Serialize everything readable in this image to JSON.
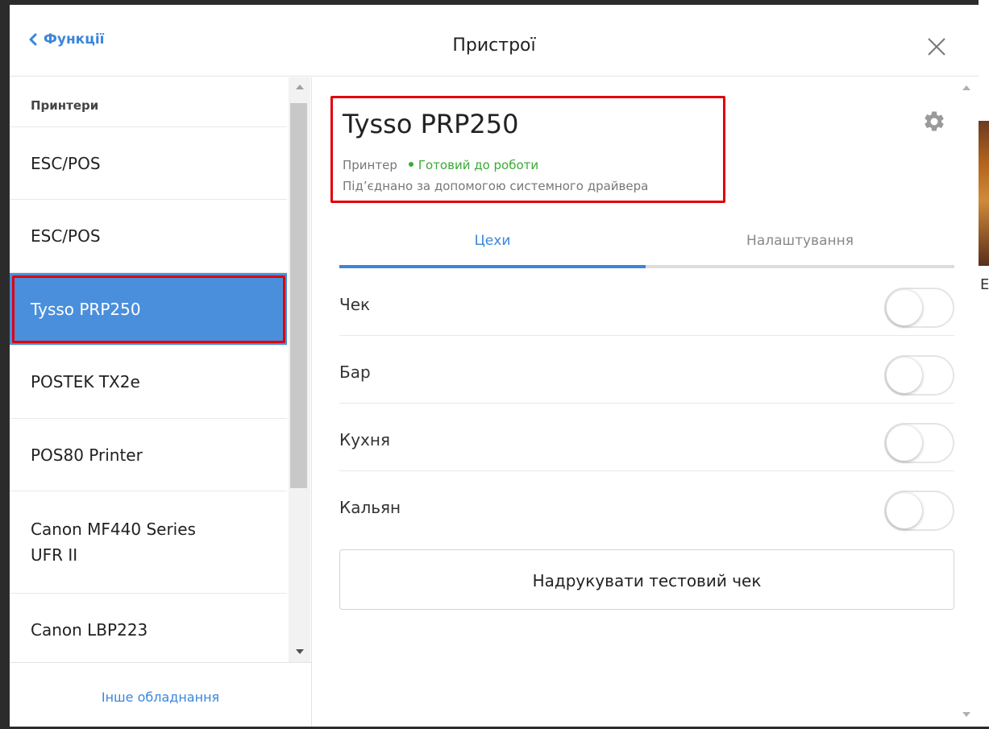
{
  "header": {
    "back_label": "Функції",
    "title": "Пристрої"
  },
  "sidebar": {
    "section_title": "Принтери",
    "items": [
      {
        "label": "ESC/POS"
      },
      {
        "label": "ESC/POS"
      },
      {
        "label": "Tysso PRP250",
        "selected": true
      },
      {
        "label": "POSTEK TX2e"
      },
      {
        "label": "POS80 Printer"
      },
      {
        "label_line1": "Canon MF440 Series",
        "label_line2": "UFR II"
      },
      {
        "label": "Canon LBP223"
      }
    ],
    "other_equipment": "Інше обладнання"
  },
  "device": {
    "name": "Tysso PRP250",
    "type": "Принтер",
    "status": "Готовий до роботи",
    "connection": "Під’єднано за допомогою системного драйвера"
  },
  "tabs": [
    {
      "label": "Цехи",
      "active": true
    },
    {
      "label": "Налаштування",
      "active": false
    }
  ],
  "workshops": [
    {
      "label": "Чек",
      "enabled": false
    },
    {
      "label": "Бар",
      "enabled": false
    },
    {
      "label": "Кухня",
      "enabled": false
    },
    {
      "label": "Кальян",
      "enabled": false
    }
  ],
  "test_print_label": "Надрукувати тестовий чек",
  "background": {
    "partial_letter": "Е"
  },
  "colors": {
    "accent": "#3a86d9",
    "selected_bg": "#4a8fdb",
    "status_green": "#3aaa35",
    "highlight_red": "#e0000a"
  }
}
